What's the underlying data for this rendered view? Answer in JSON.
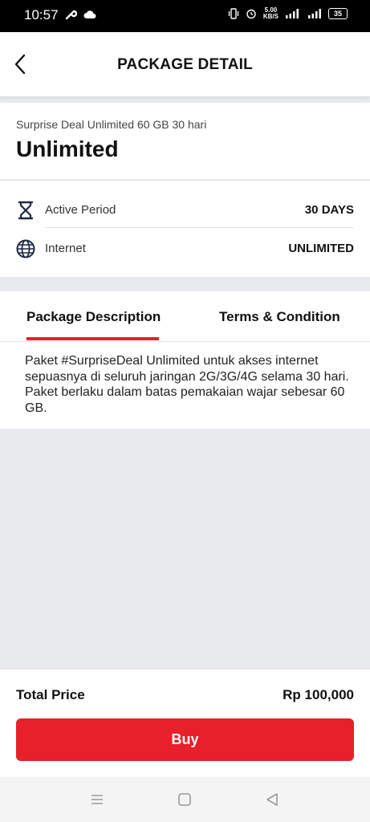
{
  "status_bar": {
    "time": "10:57",
    "net_speed_value": "5.00",
    "net_speed_unit": "KB/S",
    "battery": "35"
  },
  "header": {
    "title": "PACKAGE DETAIL",
    "back_icon": "chevron-left-icon"
  },
  "package": {
    "name": "Surprise Deal Unlimited 60 GB 30 hari",
    "type": "Unlimited"
  },
  "details": [
    {
      "icon": "hourglass-icon",
      "label": "Active Period",
      "value": "30 DAYS"
    },
    {
      "icon": "globe-icon",
      "label": "Internet",
      "value": "UNLIMITED"
    }
  ],
  "tabs": [
    {
      "label": "Package Description",
      "active": true
    },
    {
      "label": "Terms & Condition",
      "active": false
    }
  ],
  "description": "Paket #SurpriseDeal Unlimited untuk akses internet sepuasnya di seluruh jaringan 2G/3G/4G selama 30 hari. Paket berlaku dalam batas pemakaian wajar sebesar 60 GB.",
  "footer": {
    "total_label": "Total Price",
    "total_value": "Rp 100,000",
    "buy_label": "Buy"
  },
  "colors": {
    "accent": "#e8202a",
    "background": "#e8eaed"
  }
}
